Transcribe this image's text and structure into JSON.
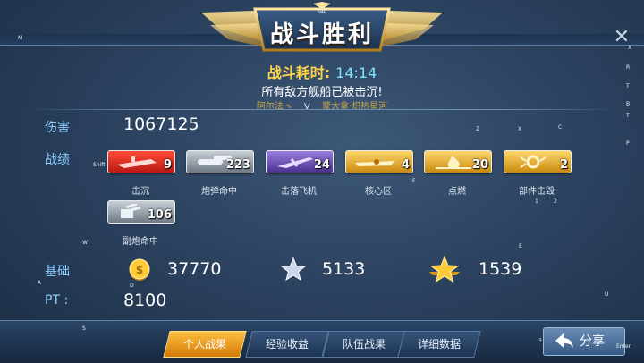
{
  "title": "战斗胜利",
  "battle_time_label": "战斗耗时:",
  "battle_time": "14:14",
  "result_text": "所有敌方舰船已被击沉!",
  "vs": {
    "left": "阿尔法",
    "sep": "V",
    "right": "蒙大拿·炽热星河"
  },
  "damage": {
    "label": "伤害",
    "value": "1067125"
  },
  "record_label": "战绩",
  "medals": [
    {
      "count": "9",
      "label": "击沉",
      "color": "red",
      "icon": "ship-sinking-icon"
    },
    {
      "count": "223",
      "label": "炮弹命中",
      "color": "gray",
      "icon": "shell-icon"
    },
    {
      "count": "24",
      "label": "击落飞机",
      "color": "purple",
      "icon": "plane-icon"
    },
    {
      "count": "4",
      "label": "核心区",
      "color": "gold",
      "icon": "ship-core-icon"
    },
    {
      "count": "20",
      "label": "点燃",
      "color": "gold",
      "icon": "fire-icon"
    },
    {
      "count": "2",
      "label": "部件击毁",
      "color": "gold",
      "icon": "gear-explosion-icon"
    },
    {
      "count": "106",
      "label": "副炮命中",
      "color": "gray",
      "icon": "secondary-gun-icon"
    }
  ],
  "base": {
    "label": "基础",
    "coins": "37770",
    "silver_xp": "5133",
    "gold_xp": "1539"
  },
  "pt": {
    "label": "PT :",
    "value": "8100"
  },
  "tabs": [
    "个人战果",
    "经验收益",
    "队伍战果",
    "详细数据"
  ],
  "active_tab": 0,
  "share_label": "分享",
  "key_hints": [
    "Tab",
    "M",
    "Shift",
    "W",
    "A",
    "S",
    "D",
    "Enter",
    "R",
    "T",
    "P",
    "Z",
    "X",
    "C",
    "F",
    "U",
    "1",
    "2",
    "3",
    "B",
    "X",
    "T",
    "E"
  ]
}
